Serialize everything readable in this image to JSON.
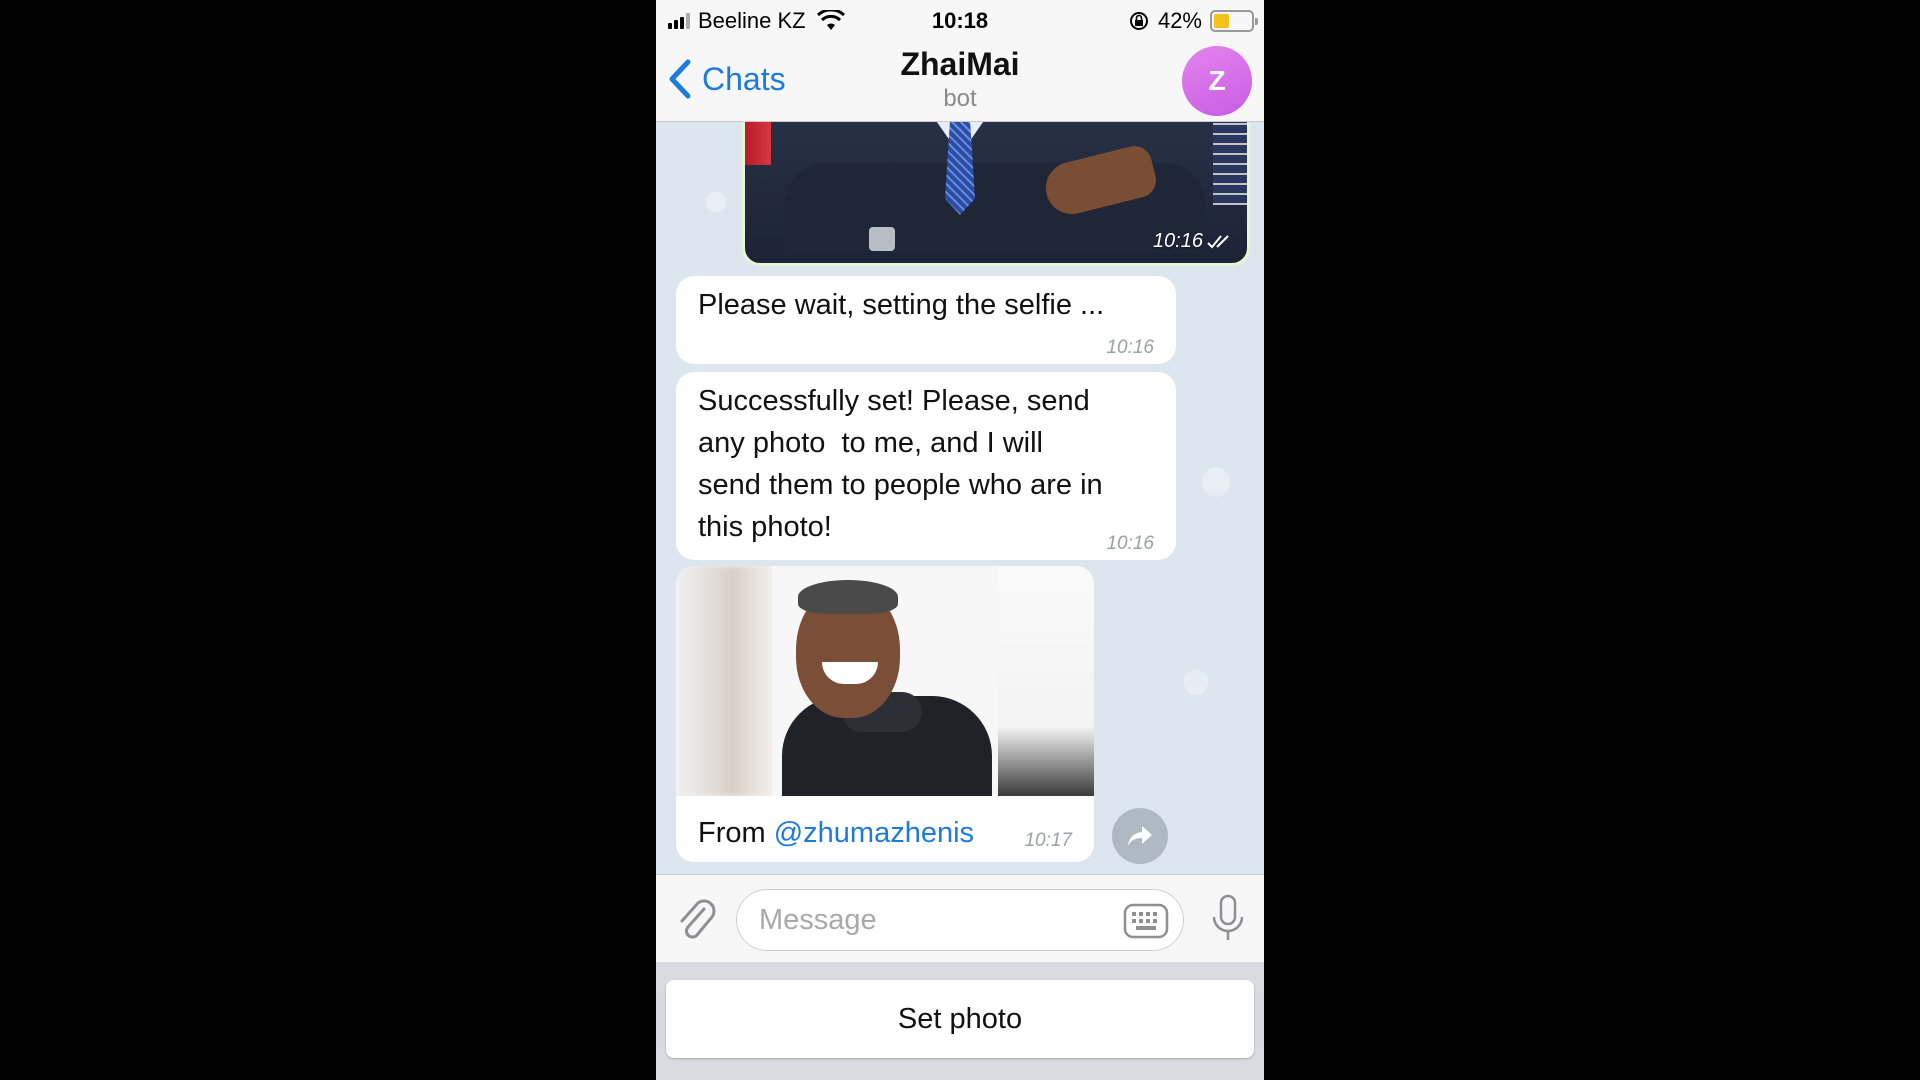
{
  "status_bar": {
    "carrier": "Beeline KZ",
    "time": "10:18",
    "battery_percent": "42%",
    "battery_level": 0.42
  },
  "nav": {
    "back_label": "Chats",
    "title": "ZhaiMai",
    "subtitle": "bot",
    "avatar_letter": "Z"
  },
  "messages": [
    {
      "type": "photo",
      "direction": "out",
      "time": "10:16"
    },
    {
      "type": "text",
      "direction": "in",
      "text": "Please wait, setting the selfie ...",
      "time": "10:16"
    },
    {
      "type": "text",
      "direction": "in",
      "text": "Successfully set! Please, send\nany photo  to me, and I will\nsend them to people who are in\nthis photo!",
      "time": "10:16"
    },
    {
      "type": "photo",
      "direction": "in",
      "caption_prefix": "From ",
      "caption_link": "@zhumazhenis",
      "time": "10:17"
    }
  ],
  "input": {
    "placeholder": "Message"
  },
  "bot_keyboard": {
    "button_label": "Set photo"
  },
  "colors": {
    "accent": "#1d7bdc",
    "avatar": "#d86ce8",
    "chat_bg": "#dde5ee",
    "battery": "#f5c21b"
  }
}
